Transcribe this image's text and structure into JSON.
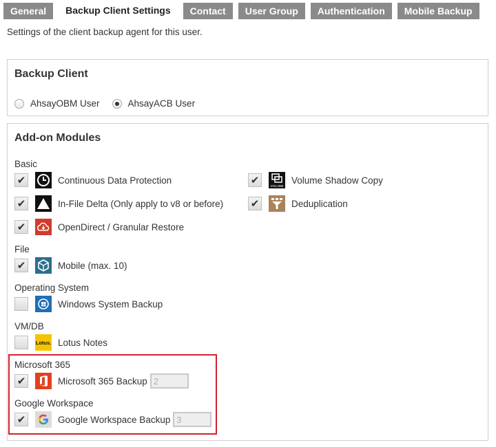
{
  "tabs": [
    {
      "label": "General",
      "active": false
    },
    {
      "label": "Backup Client Settings",
      "active": true
    },
    {
      "label": "Contact",
      "active": false
    },
    {
      "label": "User Group",
      "active": false
    },
    {
      "label": "Authentication",
      "active": false
    },
    {
      "label": "Mobile Backup",
      "active": false
    }
  ],
  "subtitle": "Settings of the client backup agent for this user.",
  "backup_client": {
    "title": "Backup Client",
    "options": [
      {
        "label": "AhsayOBM User",
        "selected": false
      },
      {
        "label": "AhsayACB User",
        "selected": true
      }
    ]
  },
  "addons": {
    "title": "Add-on Modules",
    "groups": {
      "basic": "Basic",
      "file": "File",
      "os": "Operating System",
      "vmdb": "VM/DB",
      "m365": "Microsoft 365",
      "gws": "Google Workspace"
    },
    "modules": {
      "cdp": {
        "label": "Continuous Data Protection",
        "checked": true,
        "icon": "clock-icon"
      },
      "vss": {
        "label": "Volume Shadow Copy",
        "checked": true,
        "icon": "volume-icon",
        "icon_text": "VOLUME"
      },
      "infile": {
        "label": "In-File Delta (Only apply to v8 or before)",
        "checked": true,
        "icon": "triangle-icon"
      },
      "dedup": {
        "label": "Deduplication",
        "checked": true,
        "icon": "funnel-icon"
      },
      "opendirect": {
        "label": "OpenDirect / Granular Restore",
        "checked": true,
        "icon": "cloud-icon"
      },
      "mobile": {
        "label": "Mobile (max. 10)",
        "checked": true,
        "icon": "mobile-box-icon"
      },
      "winsys": {
        "label": "Windows System Backup",
        "checked": false,
        "icon": "windows-icon"
      },
      "lotus": {
        "label": "Lotus Notes",
        "checked": false,
        "icon": "lotus-icon",
        "icon_text": "Lotus."
      },
      "m365": {
        "label": "Microsoft 365 Backup",
        "checked": true,
        "icon": "office-icon",
        "quantity": "2"
      },
      "gws": {
        "label": "Google Workspace Backup",
        "checked": true,
        "icon": "google-icon",
        "quantity": "3"
      }
    }
  },
  "colors": {
    "tab_bg": "#8a8a8a",
    "highlight_border": "#d0232d",
    "office_red": "#e3401d",
    "opendirect_red": "#d23a2a",
    "dedup_brown": "#a8845b",
    "mobile_teal": "#2b6f8e",
    "windows_blue": "#1e6fb5",
    "lotus_yellow": "#f5c400"
  }
}
